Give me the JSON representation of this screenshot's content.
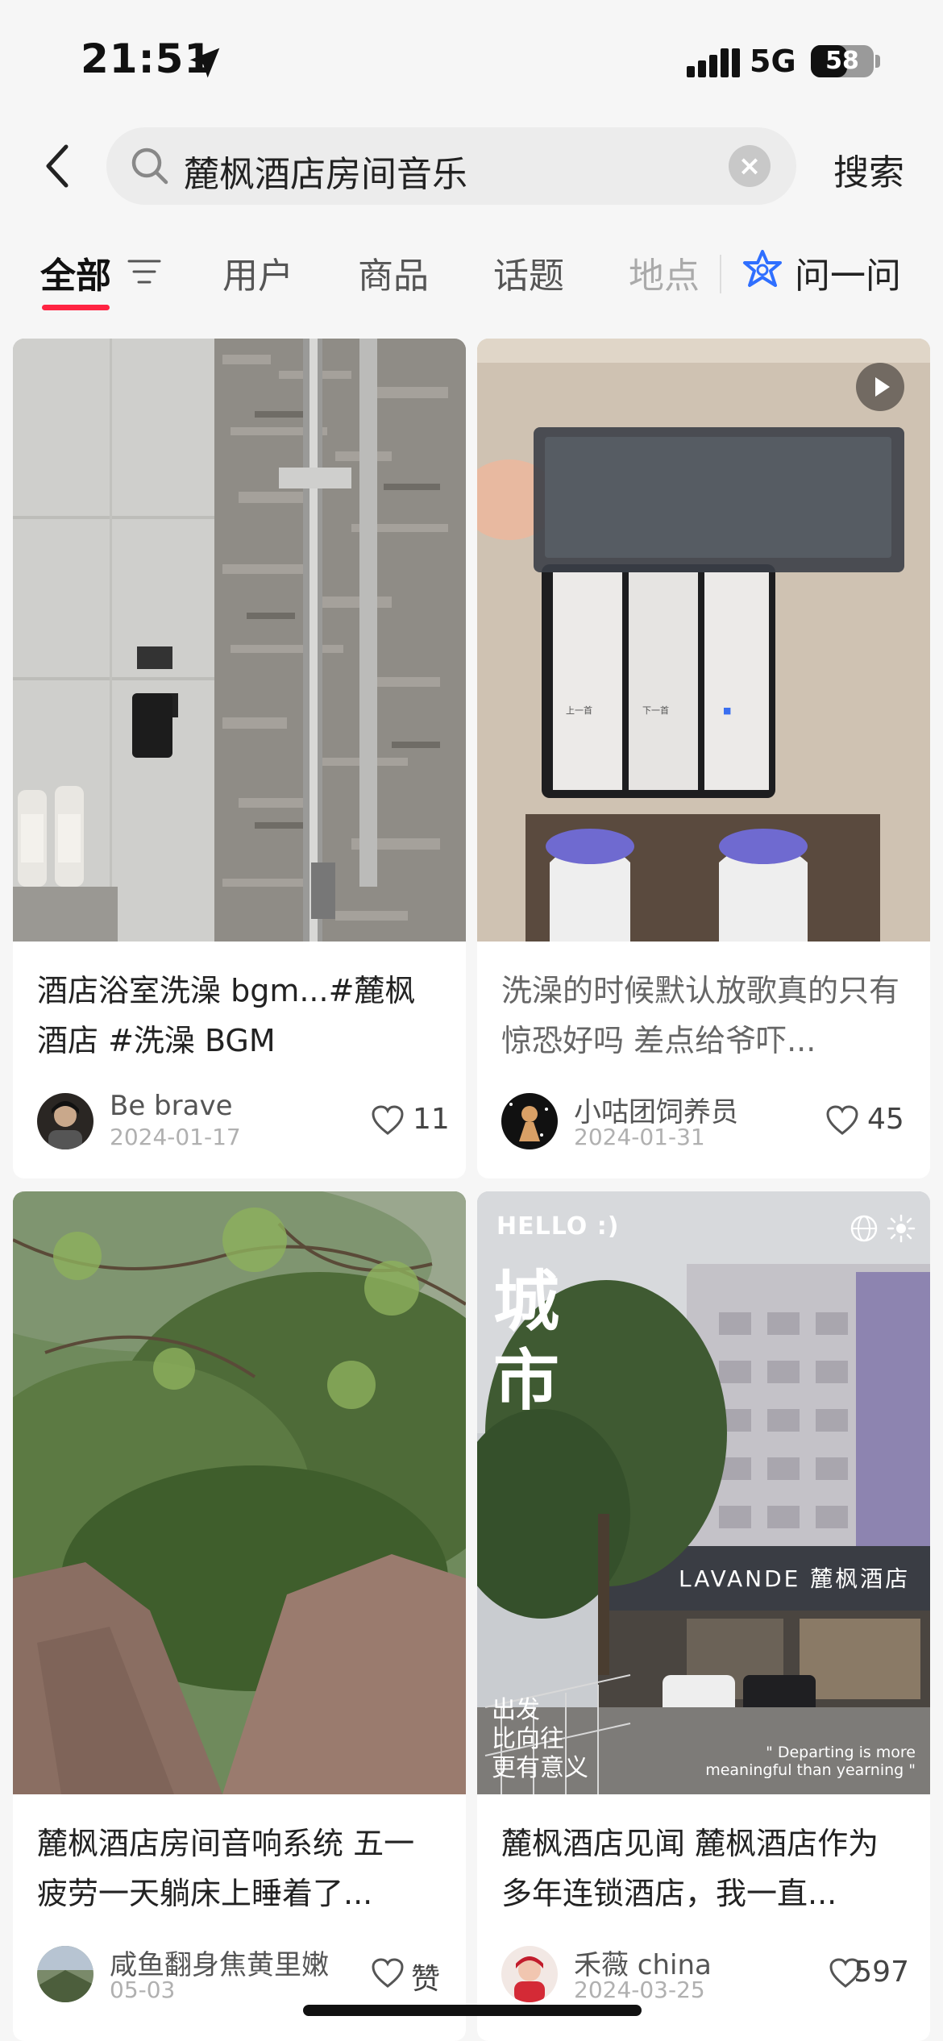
{
  "status_bar": {
    "time": "21:51",
    "network": "5G",
    "battery": "58",
    "battery_level": 0.58
  },
  "search": {
    "query": "麓枫酒店房间音乐",
    "button_label": "搜索"
  },
  "tabs": [
    {
      "label": "全部",
      "active": true
    },
    {
      "label": "用户"
    },
    {
      "label": "商品"
    },
    {
      "label": "话题"
    },
    {
      "label": "地点"
    },
    {
      "label": "问一问"
    }
  ],
  "colors": {
    "accent": "#ff2442",
    "ask_icon": "#2f6fff"
  },
  "cards": [
    {
      "title": "酒店浴室洗澡 bgm...#麓枫酒店 #洗澡 BGM",
      "author": "Be brave",
      "date": "2024-01-17",
      "likes": "11"
    },
    {
      "title": "洗澡的时候默认放歌真的只有惊恐好吗 差点给爷吓...",
      "author": "小咕团饲养员",
      "date": "2024-01-31",
      "likes": "45",
      "is_video": true
    },
    {
      "title": "麓枫酒店房间音响系统 五一疲劳一天躺床上睡着了...",
      "author": "咸鱼翻身焦黄里嫩",
      "date": "05-03",
      "likes": "赞"
    },
    {
      "title": "麓枫酒店见闻 麓枫酒店作为多年连锁酒店，我一直...",
      "author": "禾薇 china",
      "date": "2024-03-25",
      "likes": "597",
      "overlay": {
        "hello": "HELLO :)",
        "big_1": "城",
        "big_2": "市",
        "small_1": "出发",
        "small_2": "比向往",
        "small_3": "更有意义",
        "quote_1": "\" Departing is more",
        "quote_2": "meaningful than yearning \"",
        "sign_lavande": "LAVANDE 麓枫酒店"
      }
    }
  ]
}
